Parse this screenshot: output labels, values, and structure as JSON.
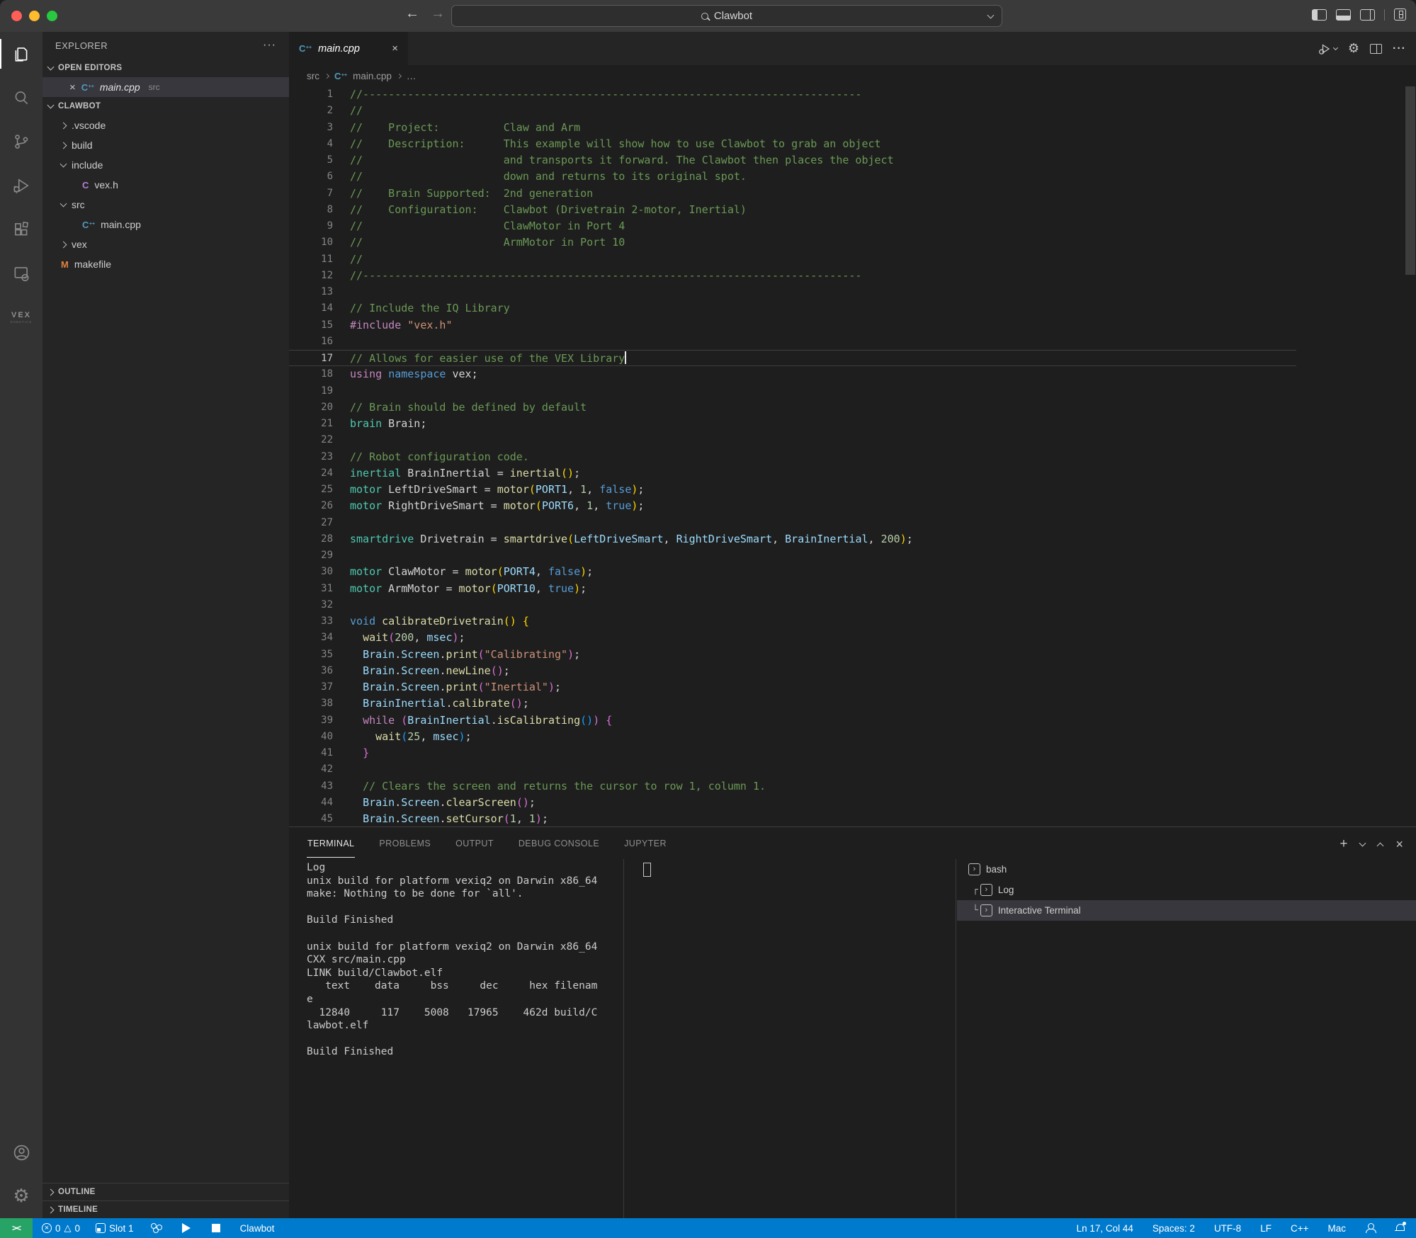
{
  "colors": {
    "accent_blue": "#007ACC",
    "remote_green": "#27A365",
    "editor_bg": "#1E1E1E",
    "sidebar_bg": "#252526",
    "activity_bg": "#333333",
    "titlebar_bg": "#3A3A3A",
    "selection_row": "#37373D"
  },
  "title_bar": {
    "search_value": "Clawbot"
  },
  "activity_bar": {
    "vex_label": "VEX",
    "vex_sublabel": "ROBOTICS"
  },
  "sidebar": {
    "title": "EXPLORER",
    "open_editors_label": "OPEN EDITORS",
    "open_editor": {
      "file": "main.cpp",
      "dir": "src"
    },
    "root_label": "CLAWBOT",
    "tree": [
      {
        "label": ".vscode",
        "indent": 1,
        "kind": "folder",
        "state": "collapsed"
      },
      {
        "label": "build",
        "indent": 1,
        "kind": "folder",
        "state": "collapsed"
      },
      {
        "label": "include",
        "indent": 1,
        "kind": "folder",
        "state": "expanded"
      },
      {
        "label": "vex.h",
        "indent": 2,
        "kind": "c-header"
      },
      {
        "label": "src",
        "indent": 1,
        "kind": "folder",
        "state": "expanded"
      },
      {
        "label": "main.cpp",
        "indent": 2,
        "kind": "cpp-file"
      },
      {
        "label": "vex",
        "indent": 1,
        "kind": "folder",
        "state": "collapsed"
      },
      {
        "label": "makefile",
        "indent": 1,
        "kind": "makefile"
      }
    ],
    "outline_label": "OUTLINE",
    "timeline_label": "TIMELINE"
  },
  "editor": {
    "tab": {
      "file": "main.cpp"
    },
    "breadcrumb": {
      "dir": "src",
      "file": "main.cpp",
      "symbol": "…"
    },
    "cursor_line": 17,
    "lines": [
      {
        "n": 1,
        "s": [
          [
            "c",
            "//------------------------------------------------------------------------------"
          ]
        ]
      },
      {
        "n": 2,
        "s": [
          [
            "c",
            "//"
          ]
        ]
      },
      {
        "n": 3,
        "s": [
          [
            "c",
            "//    Project:          Claw and Arm"
          ]
        ]
      },
      {
        "n": 4,
        "s": [
          [
            "c",
            "//    Description:      This example will show how to use Clawbot to grab an object"
          ]
        ]
      },
      {
        "n": 5,
        "s": [
          [
            "c",
            "//                      and transports it forward. The Clawbot then places the object"
          ]
        ]
      },
      {
        "n": 6,
        "s": [
          [
            "c",
            "//                      down and returns to its original spot."
          ]
        ]
      },
      {
        "n": 7,
        "s": [
          [
            "c",
            "//    Brain Supported:  2nd generation"
          ]
        ]
      },
      {
        "n": 8,
        "s": [
          [
            "c",
            "//    Configuration:    Clawbot (Drivetrain 2-motor, Inertial)"
          ]
        ]
      },
      {
        "n": 9,
        "s": [
          [
            "c",
            "//                      ClawMotor in Port 4"
          ]
        ]
      },
      {
        "n": 10,
        "s": [
          [
            "c",
            "//                      ArmMotor in Port 10"
          ]
        ]
      },
      {
        "n": 11,
        "s": [
          [
            "c",
            "//"
          ]
        ]
      },
      {
        "n": 12,
        "s": [
          [
            "c",
            "//------------------------------------------------------------------------------"
          ]
        ]
      },
      {
        "n": 13,
        "s": []
      },
      {
        "n": 14,
        "s": [
          [
            "c",
            "// Include the IQ Library"
          ]
        ]
      },
      {
        "n": 15,
        "s": [
          [
            "k",
            "#include"
          ],
          [
            "d",
            " "
          ],
          [
            "s",
            "\"vex.h\""
          ]
        ]
      },
      {
        "n": 16,
        "s": []
      },
      {
        "n": 17,
        "s": [
          [
            "c",
            "// Allows for easier use of the VEX Library"
          ],
          [
            "cur",
            ""
          ]
        ]
      },
      {
        "n": 18,
        "s": [
          [
            "k",
            "using"
          ],
          [
            "d",
            " "
          ],
          [
            "b",
            "namespace"
          ],
          [
            "d",
            " vex;"
          ]
        ]
      },
      {
        "n": 19,
        "s": []
      },
      {
        "n": 20,
        "s": [
          [
            "c",
            "// Brain should be defined by default"
          ]
        ]
      },
      {
        "n": 21,
        "s": [
          [
            "t",
            "brain"
          ],
          [
            "d",
            " Brain;"
          ]
        ]
      },
      {
        "n": 22,
        "s": []
      },
      {
        "n": 23,
        "s": [
          [
            "c",
            "// Robot configuration code."
          ]
        ]
      },
      {
        "n": 24,
        "s": [
          [
            "t",
            "inertial"
          ],
          [
            "d",
            " BrainInertial = "
          ],
          [
            "f",
            "inertial"
          ],
          [
            "p1",
            "()"
          ],
          [
            "d",
            ";"
          ]
        ]
      },
      {
        "n": 25,
        "s": [
          [
            "t",
            "motor"
          ],
          [
            "d",
            " LeftDriveSmart = "
          ],
          [
            "f",
            "motor"
          ],
          [
            "p1",
            "("
          ],
          [
            "v",
            "PORT1"
          ],
          [
            "d",
            ", "
          ],
          [
            "n",
            "1"
          ],
          [
            "d",
            ", "
          ],
          [
            "b",
            "false"
          ],
          [
            "p1",
            ")"
          ],
          [
            "d",
            ";"
          ]
        ]
      },
      {
        "n": 26,
        "s": [
          [
            "t",
            "motor"
          ],
          [
            "d",
            " RightDriveSmart = "
          ],
          [
            "f",
            "motor"
          ],
          [
            "p1",
            "("
          ],
          [
            "v",
            "PORT6"
          ],
          [
            "d",
            ", "
          ],
          [
            "n",
            "1"
          ],
          [
            "d",
            ", "
          ],
          [
            "b",
            "true"
          ],
          [
            "p1",
            ")"
          ],
          [
            "d",
            ";"
          ]
        ]
      },
      {
        "n": 27,
        "s": []
      },
      {
        "n": 28,
        "s": [
          [
            "t",
            "smartdrive"
          ],
          [
            "d",
            " Drivetrain = "
          ],
          [
            "f",
            "smartdrive"
          ],
          [
            "p1",
            "("
          ],
          [
            "v",
            "LeftDriveSmart"
          ],
          [
            "d",
            ", "
          ],
          [
            "v",
            "RightDriveSmart"
          ],
          [
            "d",
            ", "
          ],
          [
            "v",
            "BrainInertial"
          ],
          [
            "d",
            ", "
          ],
          [
            "n",
            "200"
          ],
          [
            "p1",
            ")"
          ],
          [
            "d",
            ";"
          ]
        ]
      },
      {
        "n": 29,
        "s": []
      },
      {
        "n": 30,
        "s": [
          [
            "t",
            "motor"
          ],
          [
            "d",
            " ClawMotor = "
          ],
          [
            "f",
            "motor"
          ],
          [
            "p1",
            "("
          ],
          [
            "v",
            "PORT4"
          ],
          [
            "d",
            ", "
          ],
          [
            "b",
            "false"
          ],
          [
            "p1",
            ")"
          ],
          [
            "d",
            ";"
          ]
        ]
      },
      {
        "n": 31,
        "s": [
          [
            "t",
            "motor"
          ],
          [
            "d",
            " ArmMotor = "
          ],
          [
            "f",
            "motor"
          ],
          [
            "p1",
            "("
          ],
          [
            "v",
            "PORT10"
          ],
          [
            "d",
            ", "
          ],
          [
            "b",
            "true"
          ],
          [
            "p1",
            ")"
          ],
          [
            "d",
            ";"
          ]
        ]
      },
      {
        "n": 32,
        "s": []
      },
      {
        "n": 33,
        "s": [
          [
            "b",
            "void"
          ],
          [
            "d",
            " "
          ],
          [
            "f",
            "calibrateDrivetrain"
          ],
          [
            "p1",
            "()"
          ],
          [
            "d",
            " "
          ],
          [
            "p1",
            "{"
          ]
        ]
      },
      {
        "n": 34,
        "s": [
          [
            "d",
            "  "
          ],
          [
            "f",
            "wait"
          ],
          [
            "p2",
            "("
          ],
          [
            "n",
            "200"
          ],
          [
            "d",
            ", "
          ],
          [
            "v",
            "msec"
          ],
          [
            "p2",
            ")"
          ],
          [
            "d",
            ";"
          ]
        ]
      },
      {
        "n": 35,
        "s": [
          [
            "d",
            "  "
          ],
          [
            "v",
            "Brain"
          ],
          [
            "d",
            "."
          ],
          [
            "v",
            "Screen"
          ],
          [
            "d",
            "."
          ],
          [
            "f",
            "print"
          ],
          [
            "p2",
            "("
          ],
          [
            "s",
            "\"Calibrating\""
          ],
          [
            "p2",
            ")"
          ],
          [
            "d",
            ";"
          ]
        ]
      },
      {
        "n": 36,
        "s": [
          [
            "d",
            "  "
          ],
          [
            "v",
            "Brain"
          ],
          [
            "d",
            "."
          ],
          [
            "v",
            "Screen"
          ],
          [
            "d",
            "."
          ],
          [
            "f",
            "newLine"
          ],
          [
            "p2",
            "()"
          ],
          [
            "d",
            ";"
          ]
        ]
      },
      {
        "n": 37,
        "s": [
          [
            "d",
            "  "
          ],
          [
            "v",
            "Brain"
          ],
          [
            "d",
            "."
          ],
          [
            "v",
            "Screen"
          ],
          [
            "d",
            "."
          ],
          [
            "f",
            "print"
          ],
          [
            "p2",
            "("
          ],
          [
            "s",
            "\"Inertial\""
          ],
          [
            "p2",
            ")"
          ],
          [
            "d",
            ";"
          ]
        ]
      },
      {
        "n": 38,
        "s": [
          [
            "d",
            "  "
          ],
          [
            "v",
            "BrainInertial"
          ],
          [
            "d",
            "."
          ],
          [
            "f",
            "calibrate"
          ],
          [
            "p2",
            "()"
          ],
          [
            "d",
            ";"
          ]
        ]
      },
      {
        "n": 39,
        "s": [
          [
            "d",
            "  "
          ],
          [
            "k",
            "while"
          ],
          [
            "d",
            " "
          ],
          [
            "p2",
            "("
          ],
          [
            "v",
            "BrainInertial"
          ],
          [
            "d",
            "."
          ],
          [
            "f",
            "isCalibrating"
          ],
          [
            "p3",
            "()"
          ],
          [
            "p2",
            ")"
          ],
          [
            "d",
            " "
          ],
          [
            "p2",
            "{"
          ]
        ]
      },
      {
        "n": 40,
        "s": [
          [
            "d",
            "    "
          ],
          [
            "f",
            "wait"
          ],
          [
            "p3",
            "("
          ],
          [
            "n",
            "25"
          ],
          [
            "d",
            ", "
          ],
          [
            "v",
            "msec"
          ],
          [
            "p3",
            ")"
          ],
          [
            "d",
            ";"
          ]
        ]
      },
      {
        "n": 41,
        "s": [
          [
            "d",
            "  "
          ],
          [
            "p2",
            "}"
          ]
        ]
      },
      {
        "n": 42,
        "s": []
      },
      {
        "n": 43,
        "s": [
          [
            "d",
            "  "
          ],
          [
            "c",
            "// Clears the screen and returns the cursor to row 1, column 1."
          ]
        ]
      },
      {
        "n": 44,
        "s": [
          [
            "d",
            "  "
          ],
          [
            "v",
            "Brain"
          ],
          [
            "d",
            "."
          ],
          [
            "v",
            "Screen"
          ],
          [
            "d",
            "."
          ],
          [
            "f",
            "clearScreen"
          ],
          [
            "p2",
            "()"
          ],
          [
            "d",
            ";"
          ]
        ]
      },
      {
        "n": 45,
        "s": [
          [
            "d",
            "  "
          ],
          [
            "v",
            "Brain"
          ],
          [
            "d",
            "."
          ],
          [
            "v",
            "Screen"
          ],
          [
            "d",
            "."
          ],
          [
            "f",
            "setCursor"
          ],
          [
            "p2",
            "("
          ],
          [
            "n",
            "1"
          ],
          [
            "d",
            ", "
          ],
          [
            "n",
            "1"
          ],
          [
            "p2",
            ")"
          ],
          [
            "d",
            ";"
          ]
        ]
      }
    ],
    "minimap_extra": [
      [
        "d",
        0
      ],
      [
        "d",
        26
      ],
      [
        "c",
        38
      ],
      [
        "d",
        24
      ],
      [
        "d",
        0
      ],
      [
        "c",
        30
      ],
      [
        "v",
        22
      ],
      [
        "d",
        0
      ],
      [
        "c",
        58
      ],
      [
        "v",
        30
      ],
      [
        "d",
        28
      ],
      [
        "d",
        0
      ],
      [
        "c",
        60
      ],
      [
        "v",
        30
      ],
      [
        "d",
        28
      ],
      [
        "d",
        0
      ],
      [
        "c",
        26
      ],
      [
        "v",
        40
      ],
      [
        "d",
        14
      ],
      [
        "d",
        0
      ],
      [
        "c",
        14
      ],
      [
        "v",
        36
      ],
      [
        "d",
        0
      ],
      [
        "c",
        13
      ],
      [
        "v",
        38
      ],
      [
        "d",
        0
      ],
      [
        "c",
        14
      ],
      [
        "v",
        36
      ],
      [
        "d",
        0
      ],
      [
        "c",
        13
      ],
      [
        "v",
        34
      ],
      [
        "d",
        0
      ],
      [
        "c",
        16
      ],
      [
        "v",
        40
      ],
      [
        "d",
        0
      ],
      [
        "c",
        44
      ],
      [
        "d",
        14
      ],
      [
        "v",
        40
      ],
      [
        "d",
        0
      ],
      [
        "d",
        12
      ],
      [
        "d",
        4
      ],
      [
        "d",
        0
      ],
      [
        "d",
        10
      ],
      [
        "d",
        2
      ]
    ]
  },
  "panel": {
    "tabs": [
      "TERMINAL",
      "PROBLEMS",
      "OUTPUT",
      "DEBUG CONSOLE",
      "JUPYTER"
    ],
    "active_tab": "TERMINAL",
    "terminal_output": [
      "Log",
      "unix build for platform vexiq2 on Darwin x86_64",
      "make: Nothing to be done for `all'.",
      "",
      "Build Finished",
      "",
      "unix build for platform vexiq2 on Darwin x86_64",
      "CXX src/main.cpp",
      "LINK build/Clawbot.elf",
      "   text    data     bss     dec     hex filenam",
      "e",
      "  12840     117    5008   17965    462d build/C",
      "lawbot.elf",
      "",
      "Build Finished"
    ],
    "terminal_list": [
      {
        "label": "bash",
        "indent": 0,
        "prefix": "",
        "selected": false
      },
      {
        "label": "Log",
        "indent": 1,
        "prefix": "┌",
        "selected": false
      },
      {
        "label": "Interactive Terminal",
        "indent": 1,
        "prefix": "└",
        "selected": true
      }
    ]
  },
  "status_bar": {
    "errors": "0",
    "warnings": "0",
    "slot": "Slot 1",
    "project": "Clawbot",
    "line_col": "Ln 17, Col 44",
    "indent": "Spaces: 2",
    "encoding": "UTF-8",
    "eol": "LF",
    "language": "C++",
    "os": "Mac"
  }
}
